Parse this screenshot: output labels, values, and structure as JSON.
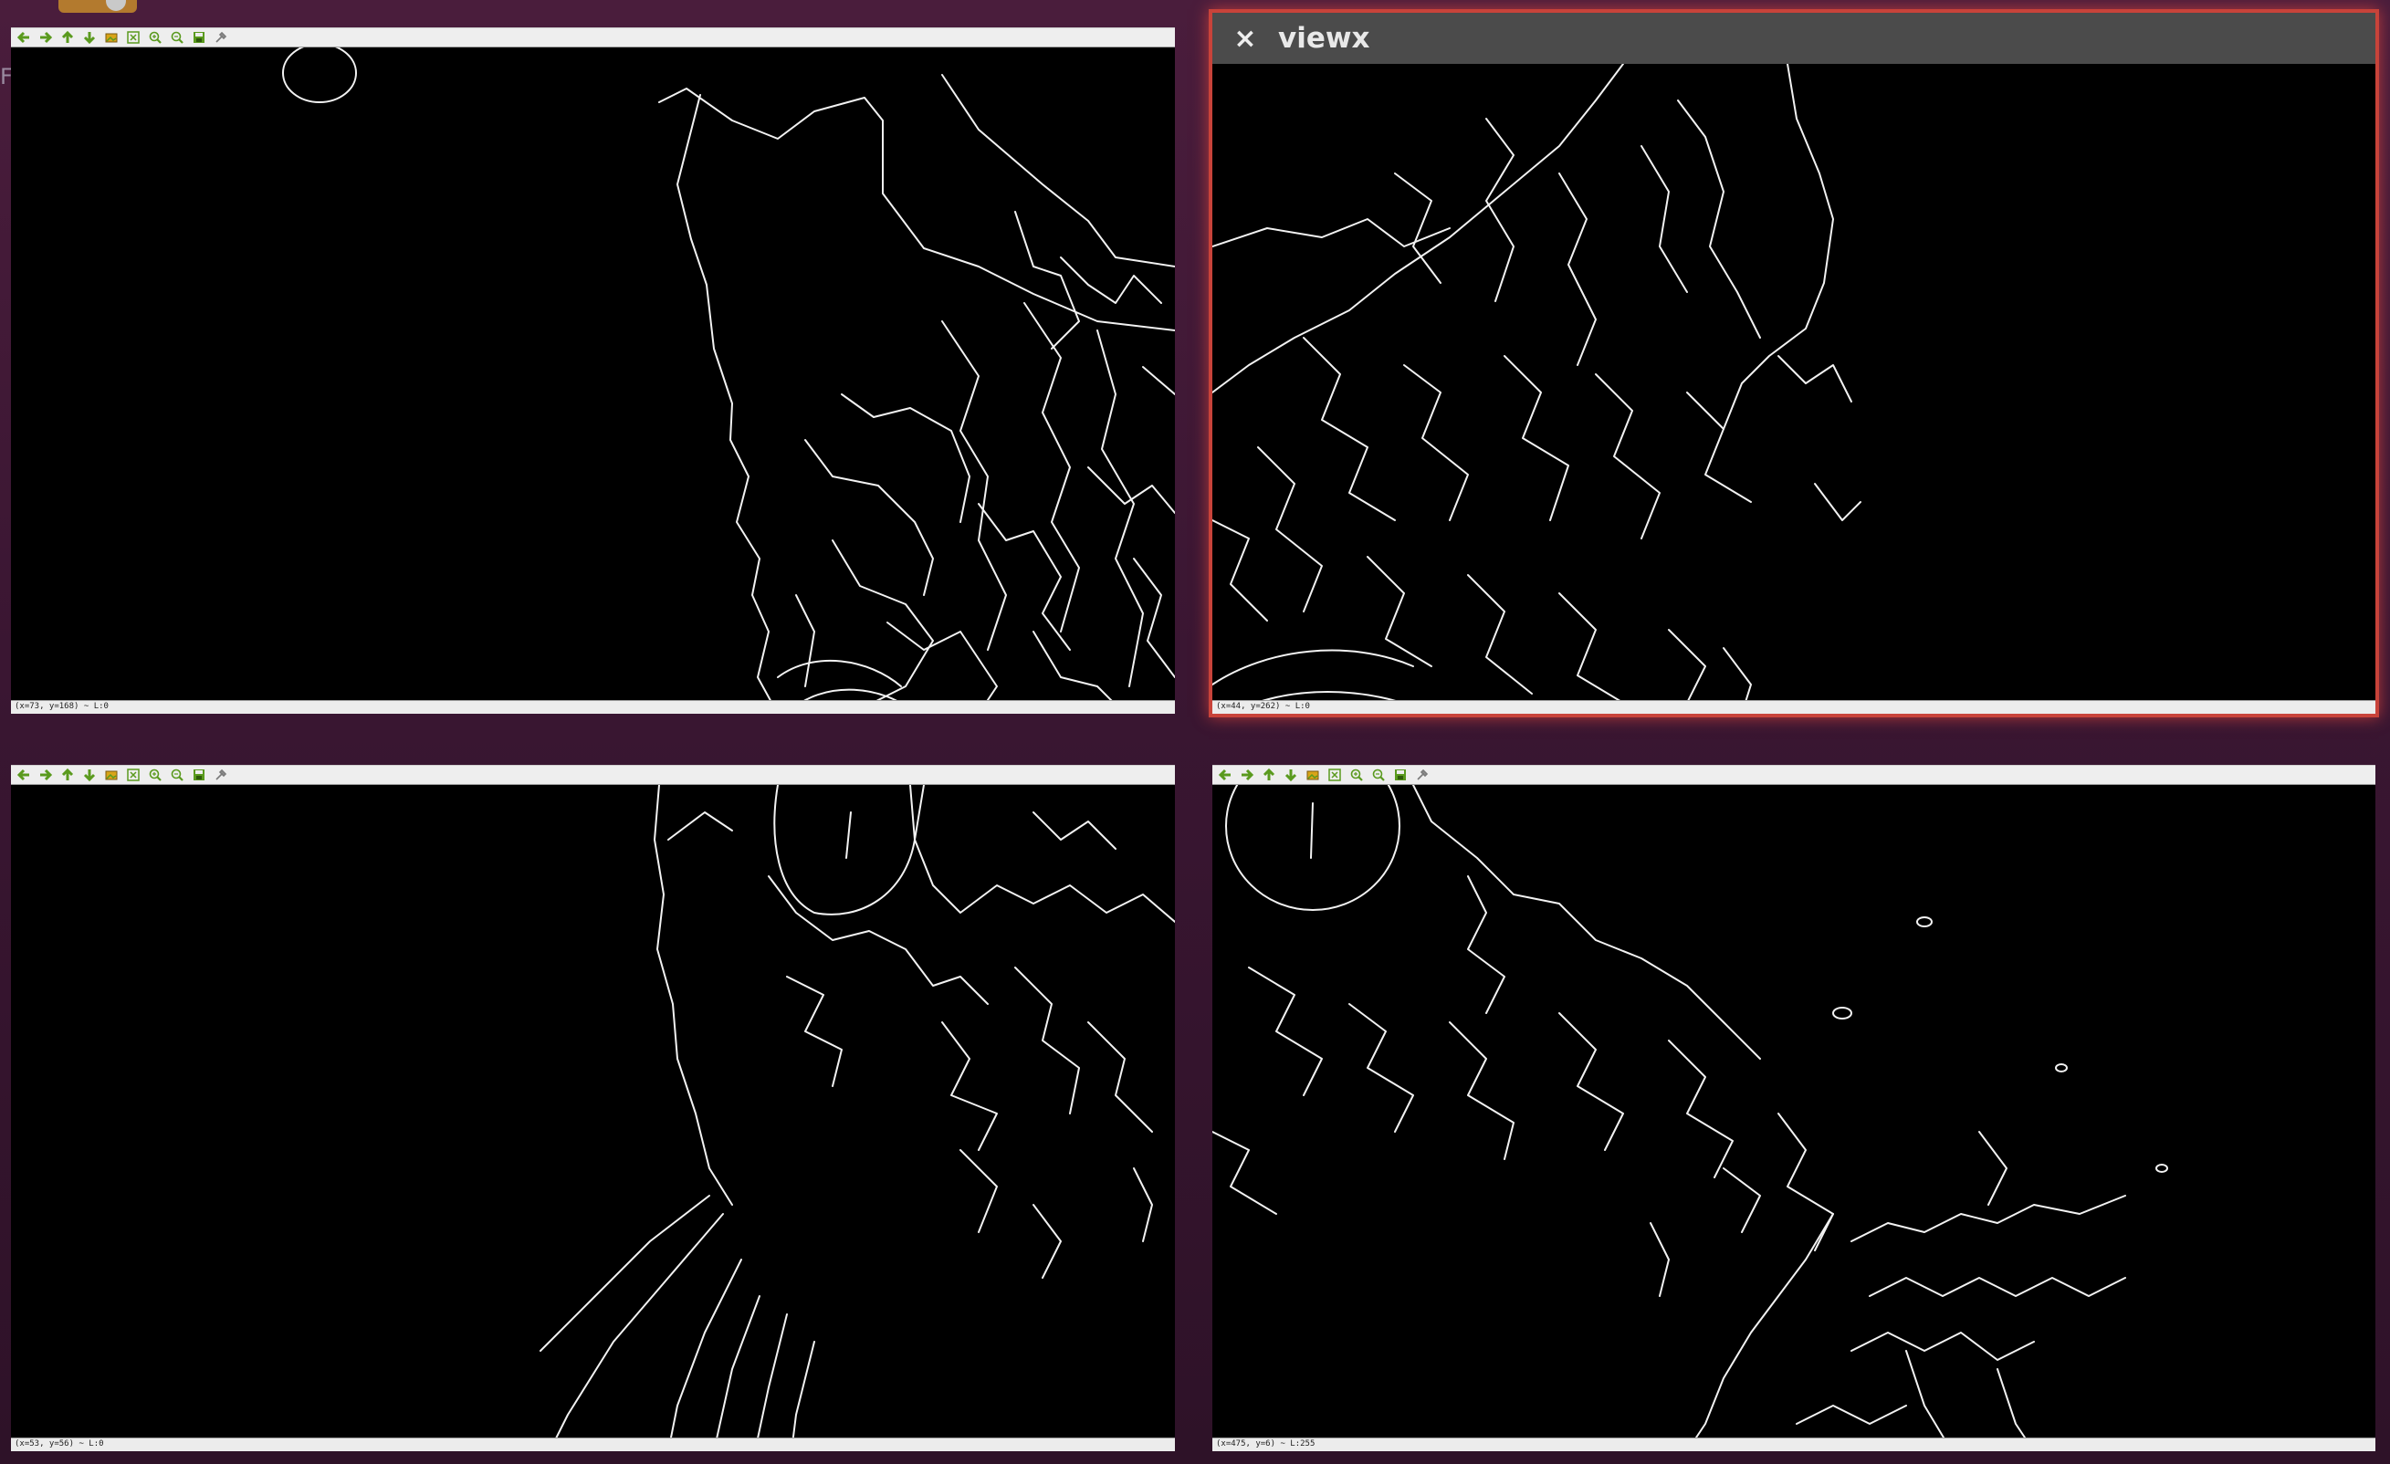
{
  "desktop": {
    "partial_char": "F"
  },
  "colors": {
    "desktop_background": "#3a1632",
    "focus_glow": "#c8433a",
    "titlebar": "#4b4b4b",
    "toolbar_icon_green": "#5a9a1e",
    "toolbar_icon_yellow": "#d8a418"
  },
  "windows": [
    {
      "name": "top-left",
      "title": "",
      "focused": false,
      "status_text": "(x=73, y=168) ~ L:0",
      "toolbar": [
        "arrow-left-icon",
        "arrow-right-icon",
        "arrow-up-icon",
        "arrow-down-icon",
        "load-image-icon",
        "zoom-fit-icon",
        "zoom-in-icon",
        "zoom-out-icon",
        "save-icon",
        "properties-icon"
      ]
    },
    {
      "name": "top-right",
      "title": "viewx",
      "focused": true,
      "close_label": "×",
      "status_text": "(x=44, y=262) ~ L:0"
    },
    {
      "name": "bottom-left",
      "title": "",
      "focused": false,
      "status_text": "(x=53, y=56) ~ L:0",
      "toolbar": [
        "arrow-left-icon",
        "arrow-right-icon",
        "arrow-up-icon",
        "arrow-down-icon",
        "load-image-icon",
        "zoom-fit-icon",
        "zoom-in-icon",
        "zoom-out-icon",
        "save-icon",
        "properties-icon"
      ]
    },
    {
      "name": "bottom-right",
      "title": "",
      "focused": false,
      "status_text": "(x=475, y=6) ~ L:255",
      "toolbar": [
        "arrow-left-icon",
        "arrow-right-icon",
        "arrow-up-icon",
        "arrow-down-icon",
        "load-image-icon",
        "zoom-fit-icon",
        "zoom-in-icon",
        "zoom-out-icon",
        "save-icon",
        "properties-icon"
      ]
    }
  ]
}
